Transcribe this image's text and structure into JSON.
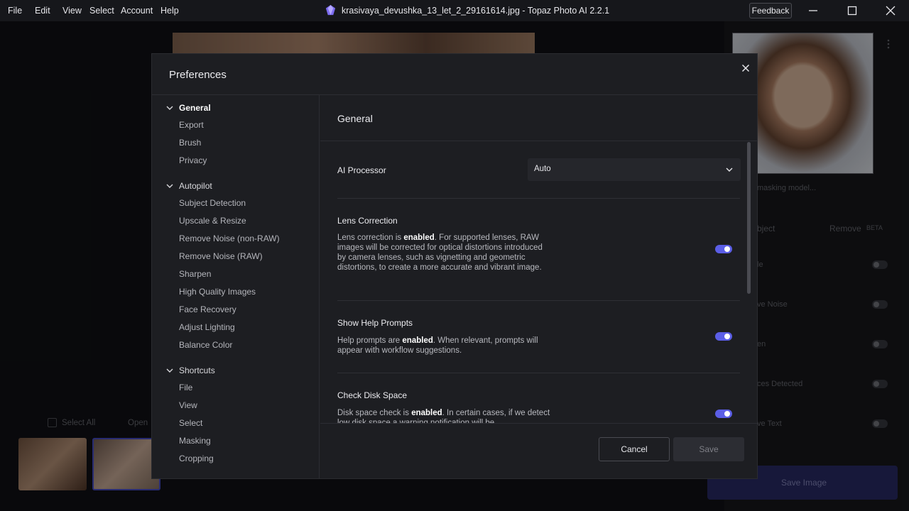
{
  "titlebar": {
    "menu": [
      "File",
      "Edit",
      "View",
      "Select",
      "Account",
      "Help"
    ],
    "title": "krasivaya_devushka_13_let_2_29161614.jpg - Topaz Photo AI 2.2.1",
    "feedback_label": "Feedback"
  },
  "background": {
    "masking_text": "masking model...",
    "subject_tab": "bject",
    "remove_tab": "Remove",
    "beta_badge": "BETA",
    "rows": [
      "le",
      "ve Noise",
      "en",
      "ces Detected",
      "ve Text"
    ],
    "select_all": "Select All",
    "open_label": "Open",
    "save_image": "Save Image"
  },
  "dialog": {
    "title": "Preferences",
    "sidebar": {
      "groups": [
        {
          "label": "General",
          "items": [
            "Export",
            "Brush",
            "Privacy"
          ]
        },
        {
          "label": "Autopilot",
          "items": [
            "Subject Detection",
            "Upscale & Resize",
            "Remove Noise (non-RAW)",
            "Remove Noise (RAW)",
            "Sharpen",
            "High Quality Images",
            "Face Recovery",
            "Adjust Lighting",
            "Balance Color"
          ]
        },
        {
          "label": "Shortcuts",
          "items": [
            "File",
            "View",
            "Select",
            "Masking",
            "Cropping"
          ]
        }
      ]
    },
    "content": {
      "title": "General",
      "ai_processor": {
        "label": "AI Processor",
        "value": "Auto"
      },
      "lens_correction": {
        "label": "Lens Correction",
        "desc_pre": "Lens correction is ",
        "desc_bold": "enabled",
        "desc_post": ". For supported lenses, RAW images will be corrected for optical distortions introduced by camera lenses, such as vignetting and geometric distortions, to create a more accurate and vibrant image.",
        "enabled": true
      },
      "help_prompts": {
        "label": "Show Help Prompts",
        "desc_pre": "Help prompts are ",
        "desc_bold": "enabled",
        "desc_post": ". When relevant, prompts will appear with workflow suggestions.",
        "enabled": true
      },
      "disk_space": {
        "label": "Check Disk Space",
        "desc_pre": "Disk space check is ",
        "desc_bold": "enabled",
        "desc_post": ". In certain cases, if we detect low disk space a warning notification will be",
        "enabled": true
      }
    },
    "footer": {
      "cancel_label": "Cancel",
      "save_label": "Save"
    }
  },
  "colors": {
    "accent": "#5b5ee6",
    "dialog_bg": "#1d1e22",
    "app_bg": "#111216"
  }
}
